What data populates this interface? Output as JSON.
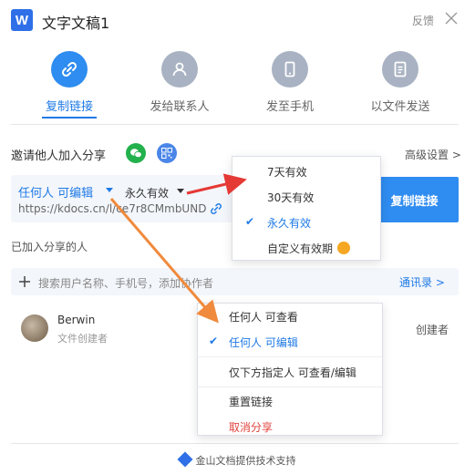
{
  "header": {
    "logo_letter": "W",
    "title": "文字文稿1",
    "feedback": "反馈"
  },
  "tabs": [
    {
      "label": "复制链接",
      "icon": "link-icon",
      "active": true
    },
    {
      "label": "发给联系人",
      "icon": "person-icon",
      "active": false
    },
    {
      "label": "发至手机",
      "icon": "phone-icon",
      "active": false
    },
    {
      "label": "以文件发送",
      "icon": "file-icon",
      "active": false
    }
  ],
  "invite": {
    "label": "邀请他人加入分享",
    "advanced": "高级设置 >"
  },
  "link": {
    "permission": "任何人 可编辑",
    "expiry": "永久有效",
    "url": "https://kdocs.cn/l/ce7r8CMmbUND",
    "copy_button": "复制链接"
  },
  "joined_label": "已加入分享的人",
  "search": {
    "placeholder": "搜索用户名称、手机号，添加协作者",
    "contacts": "通讯录 >"
  },
  "member": {
    "name": "Berwin",
    "role": "文件创建者",
    "badge": "创建者"
  },
  "expiry_menu": {
    "items": [
      "7天有效",
      "30天有效",
      "永久有效",
      "自定义有效期"
    ],
    "selected": "永久有效"
  },
  "permission_menu": {
    "items": [
      "任何人 可查看",
      "任何人 可编辑",
      "仅下方指定人 可查看/编辑",
      "重置链接",
      "取消分享"
    ],
    "selected": "任何人 可编辑"
  },
  "footer": "金山文档提供技术支持",
  "colors": {
    "accent": "#2f8cf0",
    "danger": "#e0443e",
    "arrow_red": "#e53935",
    "arrow_orange": "#f08a3c"
  }
}
